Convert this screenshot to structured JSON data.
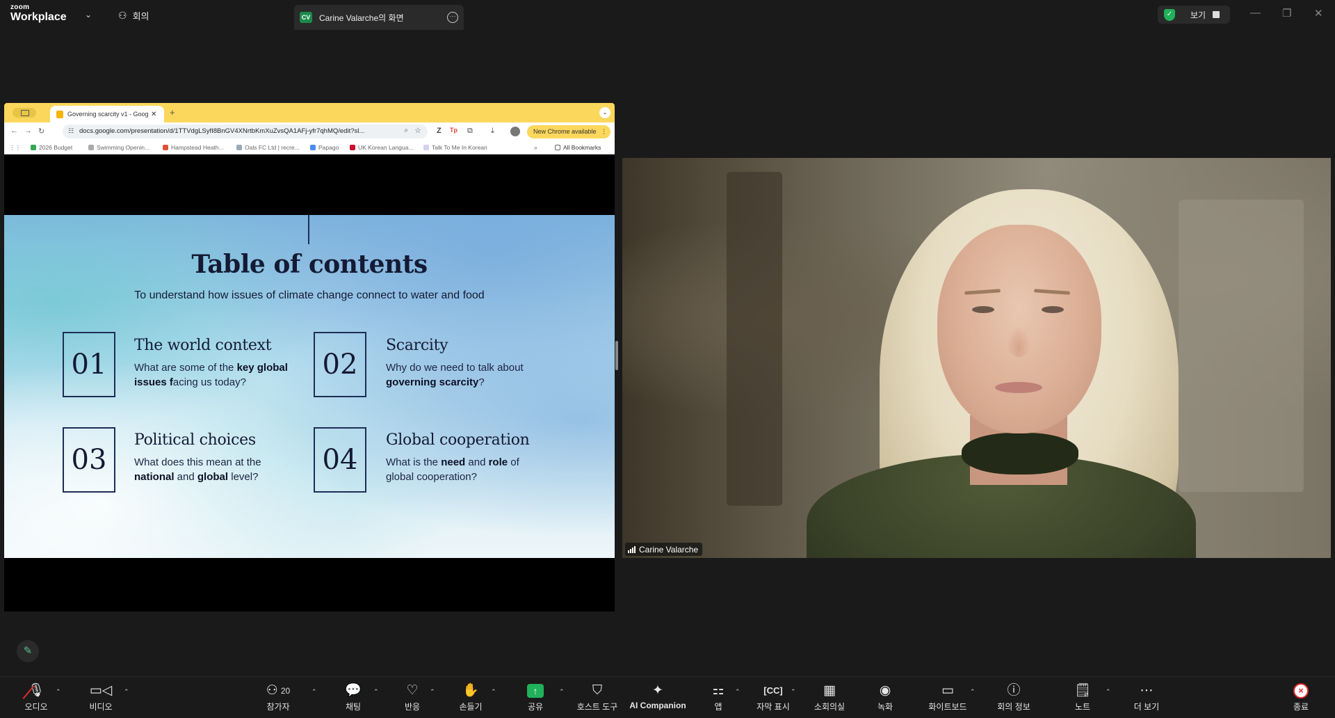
{
  "app": {
    "logo_small": "zoom",
    "logo_big": "Workplace",
    "meeting_label": "회의",
    "share_tab_initials": "CV",
    "share_tab_title": "Carine Valarche의 화면",
    "view_label": "보기"
  },
  "browser": {
    "tab_title": "Governing scarcity v1 - Goog",
    "url": "docs.google.com/presentation/d/1TTVdgLSyfI8BnGV4XNrtbKmXuZvsQA1AFj-yfr7qhMQ/edit?sl...",
    "update_label": "New Chrome available",
    "bookmarks": [
      "2026 Budget",
      "Swimming Openin...",
      "Hampstead Heath...",
      "Oals FC Ltd | recre...",
      "Papago",
      "UK Korean Langua...",
      "Talk To Me In Korean"
    ],
    "all_bookmarks": "All Bookmarks"
  },
  "slide": {
    "title": "Table of contents",
    "subtitle": "To understand how issues of climate change connect to water and food",
    "items": [
      {
        "num": "01",
        "title": "The world context",
        "desc_a": "What are some of the ",
        "desc_b": "key global issues f",
        "desc_c": "acing us today?"
      },
      {
        "num": "02",
        "title": "Scarcity",
        "desc_a": "Why do we need to talk about ",
        "desc_b": "governing scarcity",
        "desc_c": "?"
      },
      {
        "num": "03",
        "title": "Political choices",
        "desc_a": "What does this mean at the ",
        "desc_b": "national",
        "desc_c": " and ",
        "desc_d": "global",
        "desc_e": " level?"
      },
      {
        "num": "04",
        "title": "Global cooperation",
        "desc_a": "What is the ",
        "desc_b": "need",
        "desc_c": " and ",
        "desc_d": "role",
        "desc_e": " of global cooperation?"
      }
    ]
  },
  "video": {
    "participant_name": "Carine Valarche"
  },
  "toolbar": {
    "audio": "오디오",
    "video": "비디오",
    "participants": "참가자",
    "participants_count": "20",
    "chat": "채팅",
    "reactions": "반응",
    "raise_hand": "손들기",
    "share": "공유",
    "host_tools": "호스트 도구",
    "ai_companion": "AI Companion",
    "apps": "앱",
    "captions": "자막 표시",
    "breakout": "소회의실",
    "record": "녹화",
    "whiteboard": "화이트보드",
    "meeting_info": "회의 정보",
    "notes": "노트",
    "more": "더 보기",
    "end": "종료"
  },
  "colors": {
    "accent_green": "#21b15a",
    "end_red": "#e02828",
    "chrome_yellow": "#fbd75b"
  }
}
